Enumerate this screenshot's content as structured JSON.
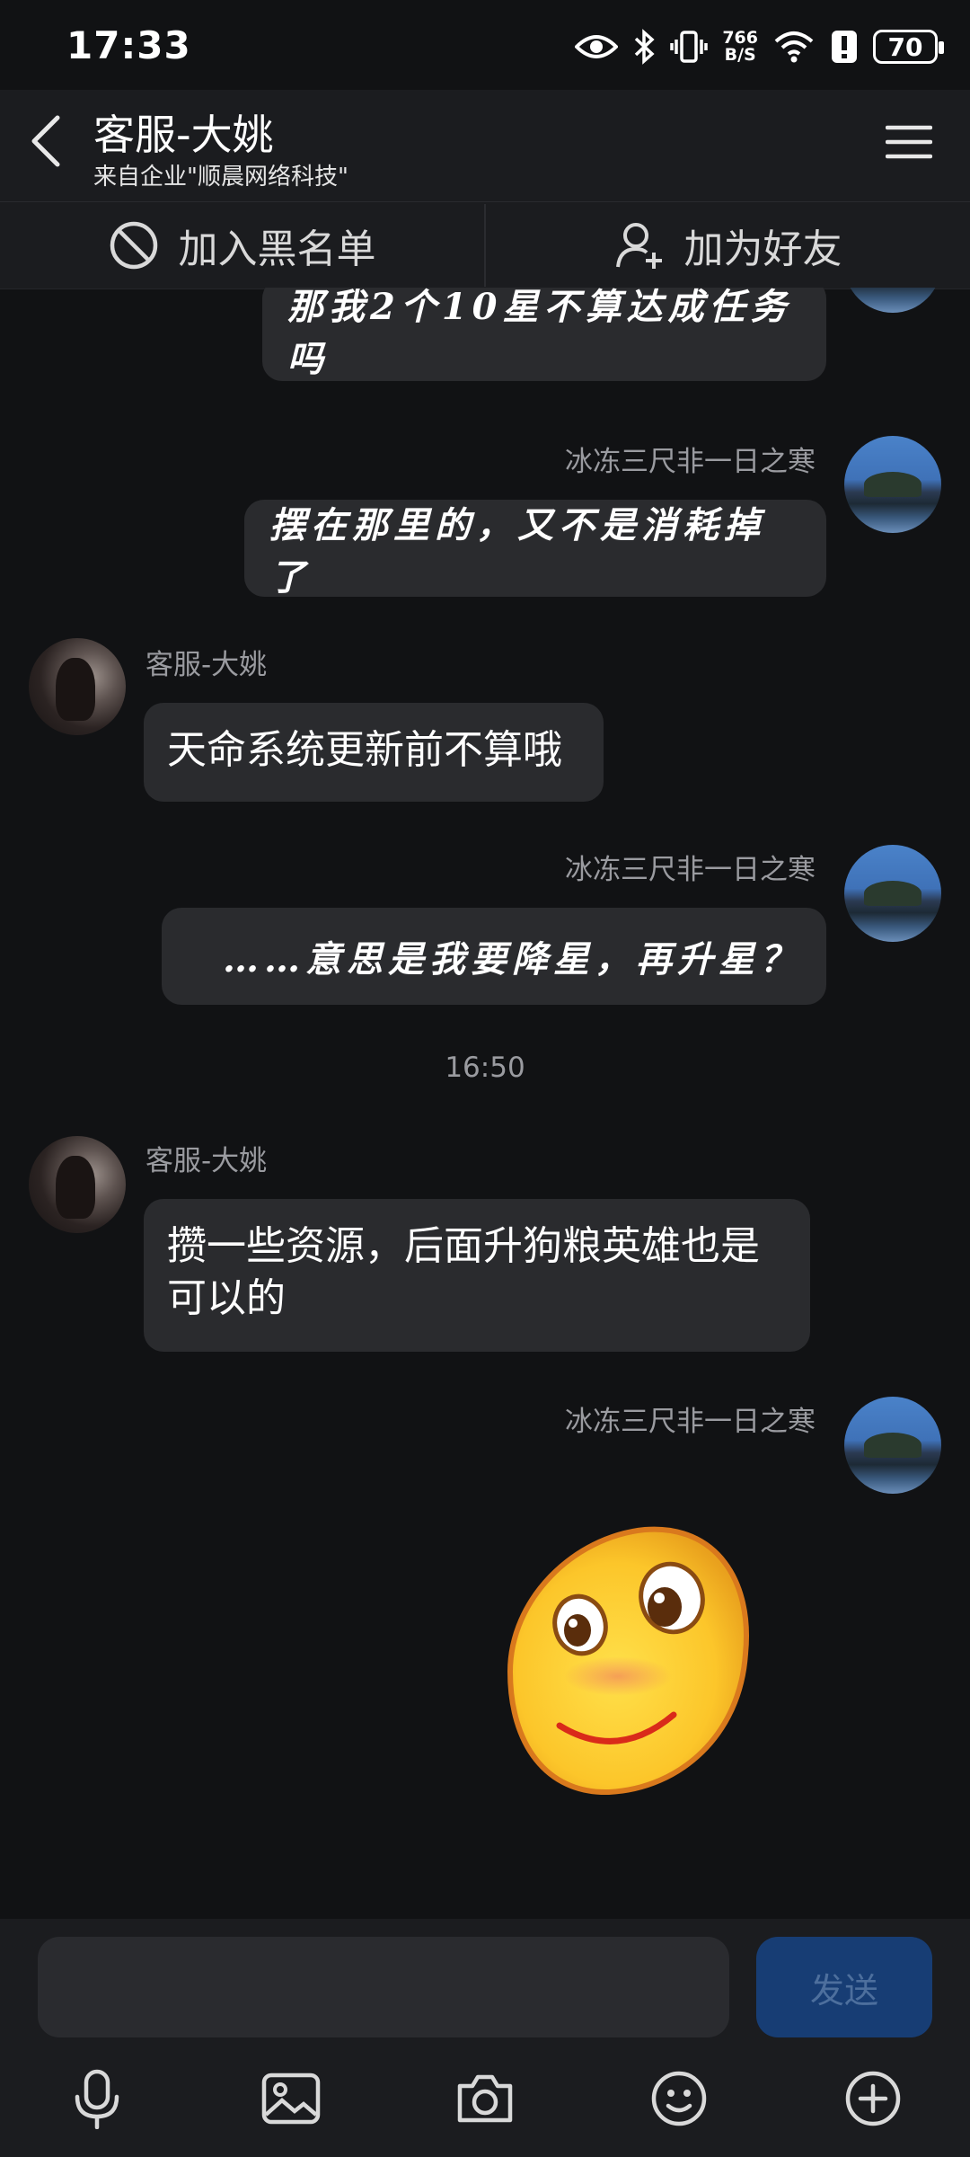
{
  "status_bar": {
    "time": "17:33",
    "net_speed_top": "766",
    "net_speed_bottom": "B/S",
    "battery": "70"
  },
  "header": {
    "title": "客服-大姚",
    "subtitle": "来自企业\"顺晨网络科技\""
  },
  "actions": {
    "blacklist_label": "加入黑名单",
    "add_friend_label": "加为好友"
  },
  "messages": [
    {
      "sender": "",
      "text": "那我2个10星不算达成任务吗"
    },
    {
      "sender": "冰冻三尺非一日之寒",
      "text": "摆在那里的，又不是消耗掉了"
    },
    {
      "sender": "客服-大姚",
      "text": "天命系统更新前不算哦"
    },
    {
      "sender": "冰冻三尺非一日之寒",
      "text": "……意思是我要降星，再升星？"
    },
    {
      "timestamp": "16:50"
    },
    {
      "sender": "客服-大姚",
      "text": "攒一些资源，后面升狗粮英雄也是可以的"
    },
    {
      "sender": "冰冻三尺非一日之寒",
      "sticker": "smiley-sticker"
    }
  ],
  "composer": {
    "placeholder": "",
    "send_label": "发送"
  },
  "toolbar_icons": [
    "microphone-icon",
    "image-icon",
    "camera-icon",
    "emoji-icon",
    "plus-circle-icon"
  ],
  "colors": {
    "background": "#111214",
    "bubble": "#2a2b2e",
    "send_button": "#173d74"
  }
}
